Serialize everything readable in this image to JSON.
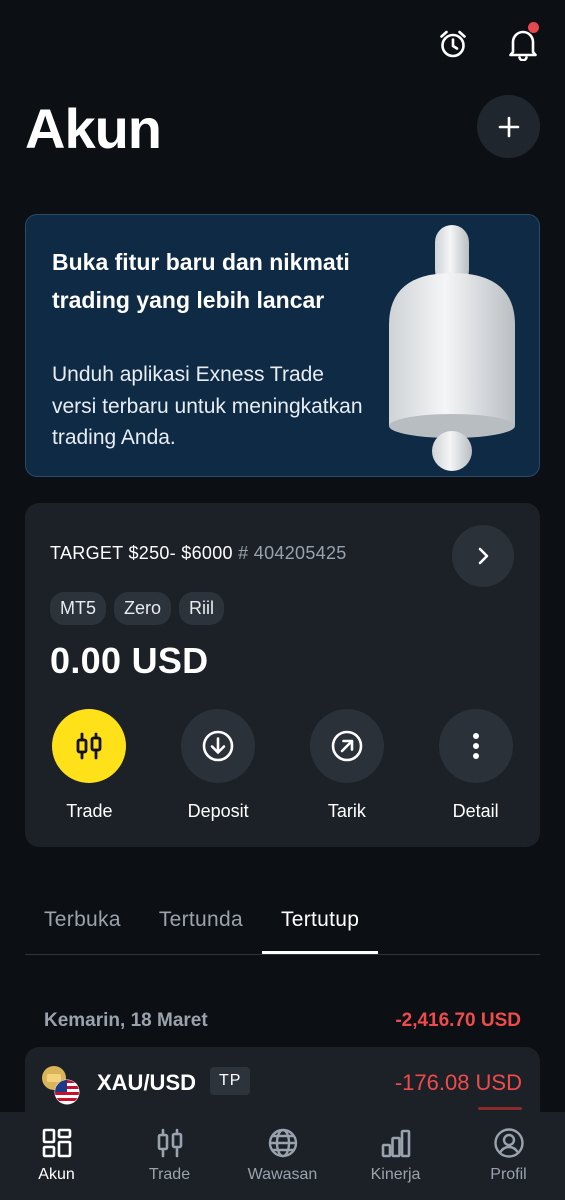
{
  "header": {
    "title": "Akun",
    "icons": [
      "alarm-clock-icon",
      "bell-icon",
      "plus-icon"
    ]
  },
  "promo": {
    "title": "Buka fitur baru dan nikmati trading yang lebih lancar",
    "body": "Unduh aplikasi Exness Trade versi terbaru untuk meningkatkan trading Anda."
  },
  "account": {
    "name": "TARGET $250- $6000",
    "number": "# 404205425",
    "tags": [
      "MT5",
      "Zero",
      "Riil"
    ],
    "balance": "0.00 USD",
    "actions": [
      {
        "label": "Trade",
        "icon": "candlestick-icon"
      },
      {
        "label": "Deposit",
        "icon": "download-circle-icon"
      },
      {
        "label": "Tarik",
        "icon": "arrow-up-right-circle-icon"
      },
      {
        "label": "Detail",
        "icon": "more-vertical-icon"
      }
    ]
  },
  "tabs": [
    {
      "label": "Terbuka",
      "active": false
    },
    {
      "label": "Tertunda",
      "active": false
    },
    {
      "label": "Tertutup",
      "active": true
    }
  ],
  "closed": {
    "date_label": "Kemarin, 18 Maret",
    "date_total": "-2,416.70 USD",
    "items": [
      {
        "symbol": "XAU/USD",
        "badge": "TP",
        "pl": "-176.08 USD"
      }
    ]
  },
  "bottom_nav": [
    {
      "label": "Akun",
      "icon": "grid-icon",
      "active": true
    },
    {
      "label": "Trade",
      "icon": "candlestick-icon",
      "active": false
    },
    {
      "label": "Wawasan",
      "icon": "globe-icon",
      "active": false
    },
    {
      "label": "Kinerja",
      "icon": "bar-chart-icon",
      "active": false
    },
    {
      "label": "Profil",
      "icon": "user-circle-icon",
      "active": false
    }
  ],
  "colors": {
    "background": "#0c1014",
    "card": "#1b2127",
    "accent_yellow": "#ffe11a",
    "loss_red": "#f04b4b",
    "promo_bg": "#0e2a44"
  }
}
